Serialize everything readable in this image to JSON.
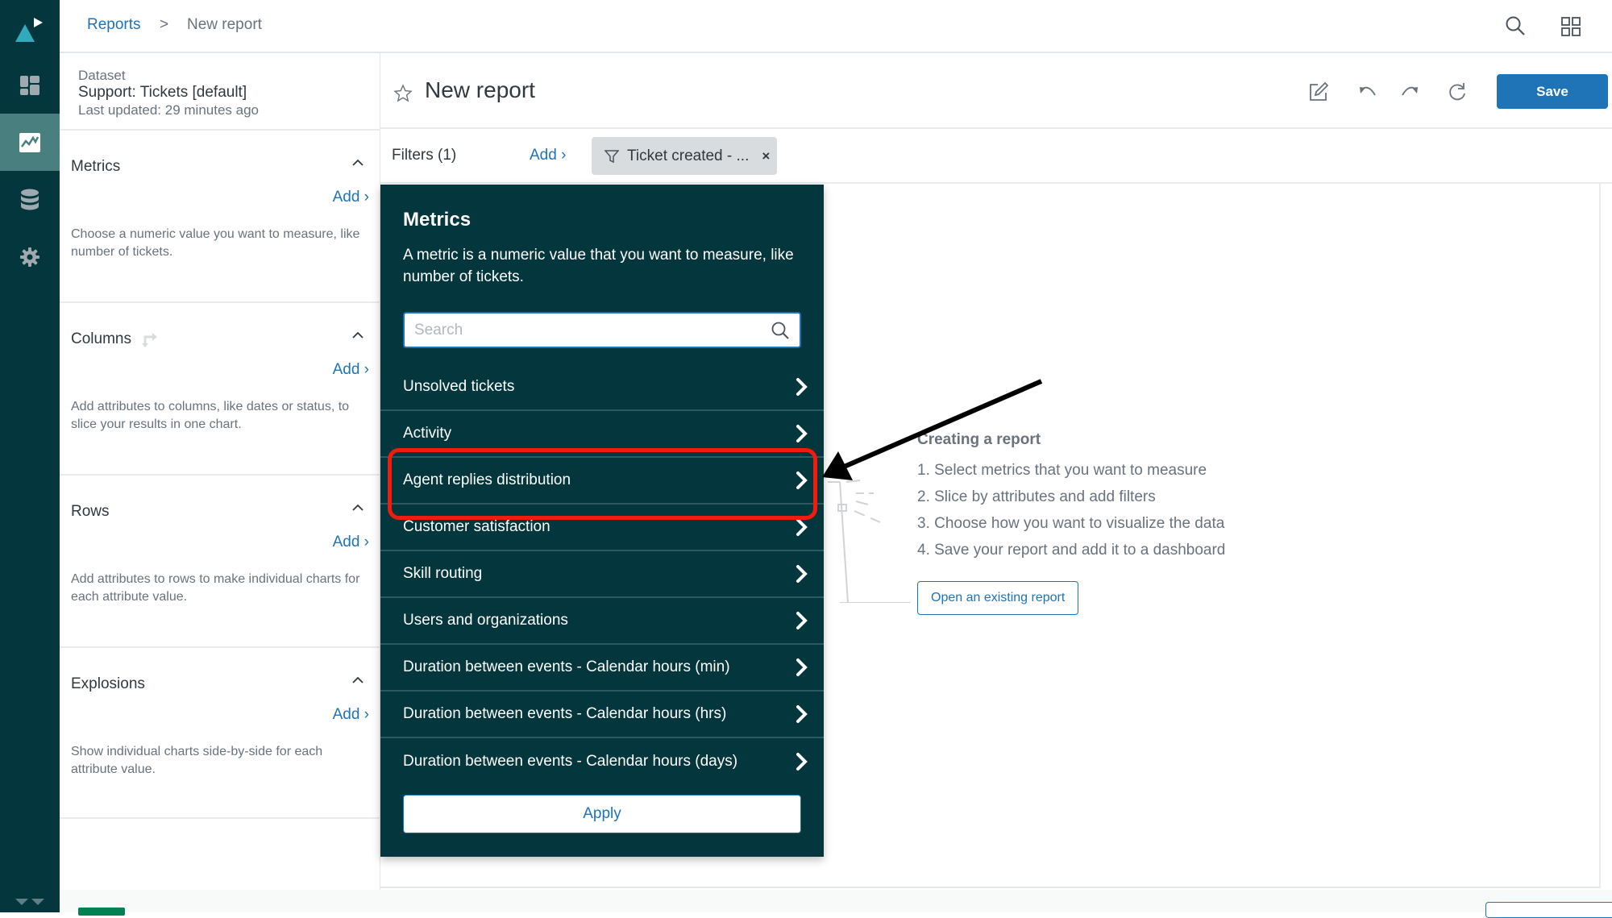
{
  "breadcrumb": {
    "parent": "Reports",
    "separator": ">",
    "current": "New report"
  },
  "header_icons": [
    "search-icon",
    "apps-grid-icon"
  ],
  "nav": {
    "items": [
      {
        "name": "logo",
        "icon": "product-logo-icon"
      },
      {
        "name": "dashboards",
        "icon": "dashboard-icon"
      },
      {
        "name": "reports",
        "icon": "line-chart-icon",
        "active": true
      },
      {
        "name": "datasets",
        "icon": "database-icon"
      },
      {
        "name": "settings",
        "icon": "gear-icon"
      }
    ]
  },
  "dataset": {
    "label": "Dataset",
    "name": "Support: Tickets [default]",
    "updated": "Last updated: 29 minutes ago"
  },
  "sections": [
    {
      "title": "Metrics",
      "add": "Add ›",
      "desc": "Choose a numeric value you want to measure, like number of tickets."
    },
    {
      "title": "Columns",
      "add": "Add ›",
      "desc": "Add attributes to columns, like dates or status, to slice your results in one chart."
    },
    {
      "title": "Rows",
      "add": "Add ›",
      "desc": "Add attributes to rows to make individual charts for each attribute value."
    },
    {
      "title": "Explosions",
      "add": "Add ›",
      "desc": "Show individual charts side-by-side for each attribute value."
    }
  ],
  "report": {
    "title": "New report",
    "save_label": "Save",
    "tools": [
      "edit-icon",
      "undo-icon",
      "redo-icon",
      "refresh-icon"
    ]
  },
  "filters": {
    "label": "Filters (1)",
    "add": "Add ›",
    "chip": "Ticket created - ...",
    "chip_remove": "×"
  },
  "popup": {
    "title": "Metrics",
    "desc": "A metric is a numeric value that you want to measure, like number of tickets.",
    "search_placeholder": "Search",
    "search_value": "",
    "items": [
      "Unsolved tickets",
      "Activity",
      "Agent replies distribution",
      "Customer satisfaction",
      "Skill routing",
      "Users and organizations",
      "Duration between events - Calendar hours (min)",
      "Duration between events - Calendar hours (hrs)",
      "Duration between events - Calendar hours (days)"
    ],
    "highlighted_item": "Agent replies distribution",
    "apply_label": "Apply"
  },
  "guide": {
    "title": "Creating a report",
    "steps": [
      "1. Select metrics that you want to measure",
      "2. Slice by attributes and add filters",
      "3. Choose how you want to visualize the data",
      "4. Save your report and add it to a dashboard"
    ],
    "open_existing": "Open an existing report"
  },
  "colors": {
    "nav_bg": "#03363d",
    "nav_active": "#4a7f80",
    "accent": "#1f73b7",
    "highlight": "#f21b0d"
  }
}
